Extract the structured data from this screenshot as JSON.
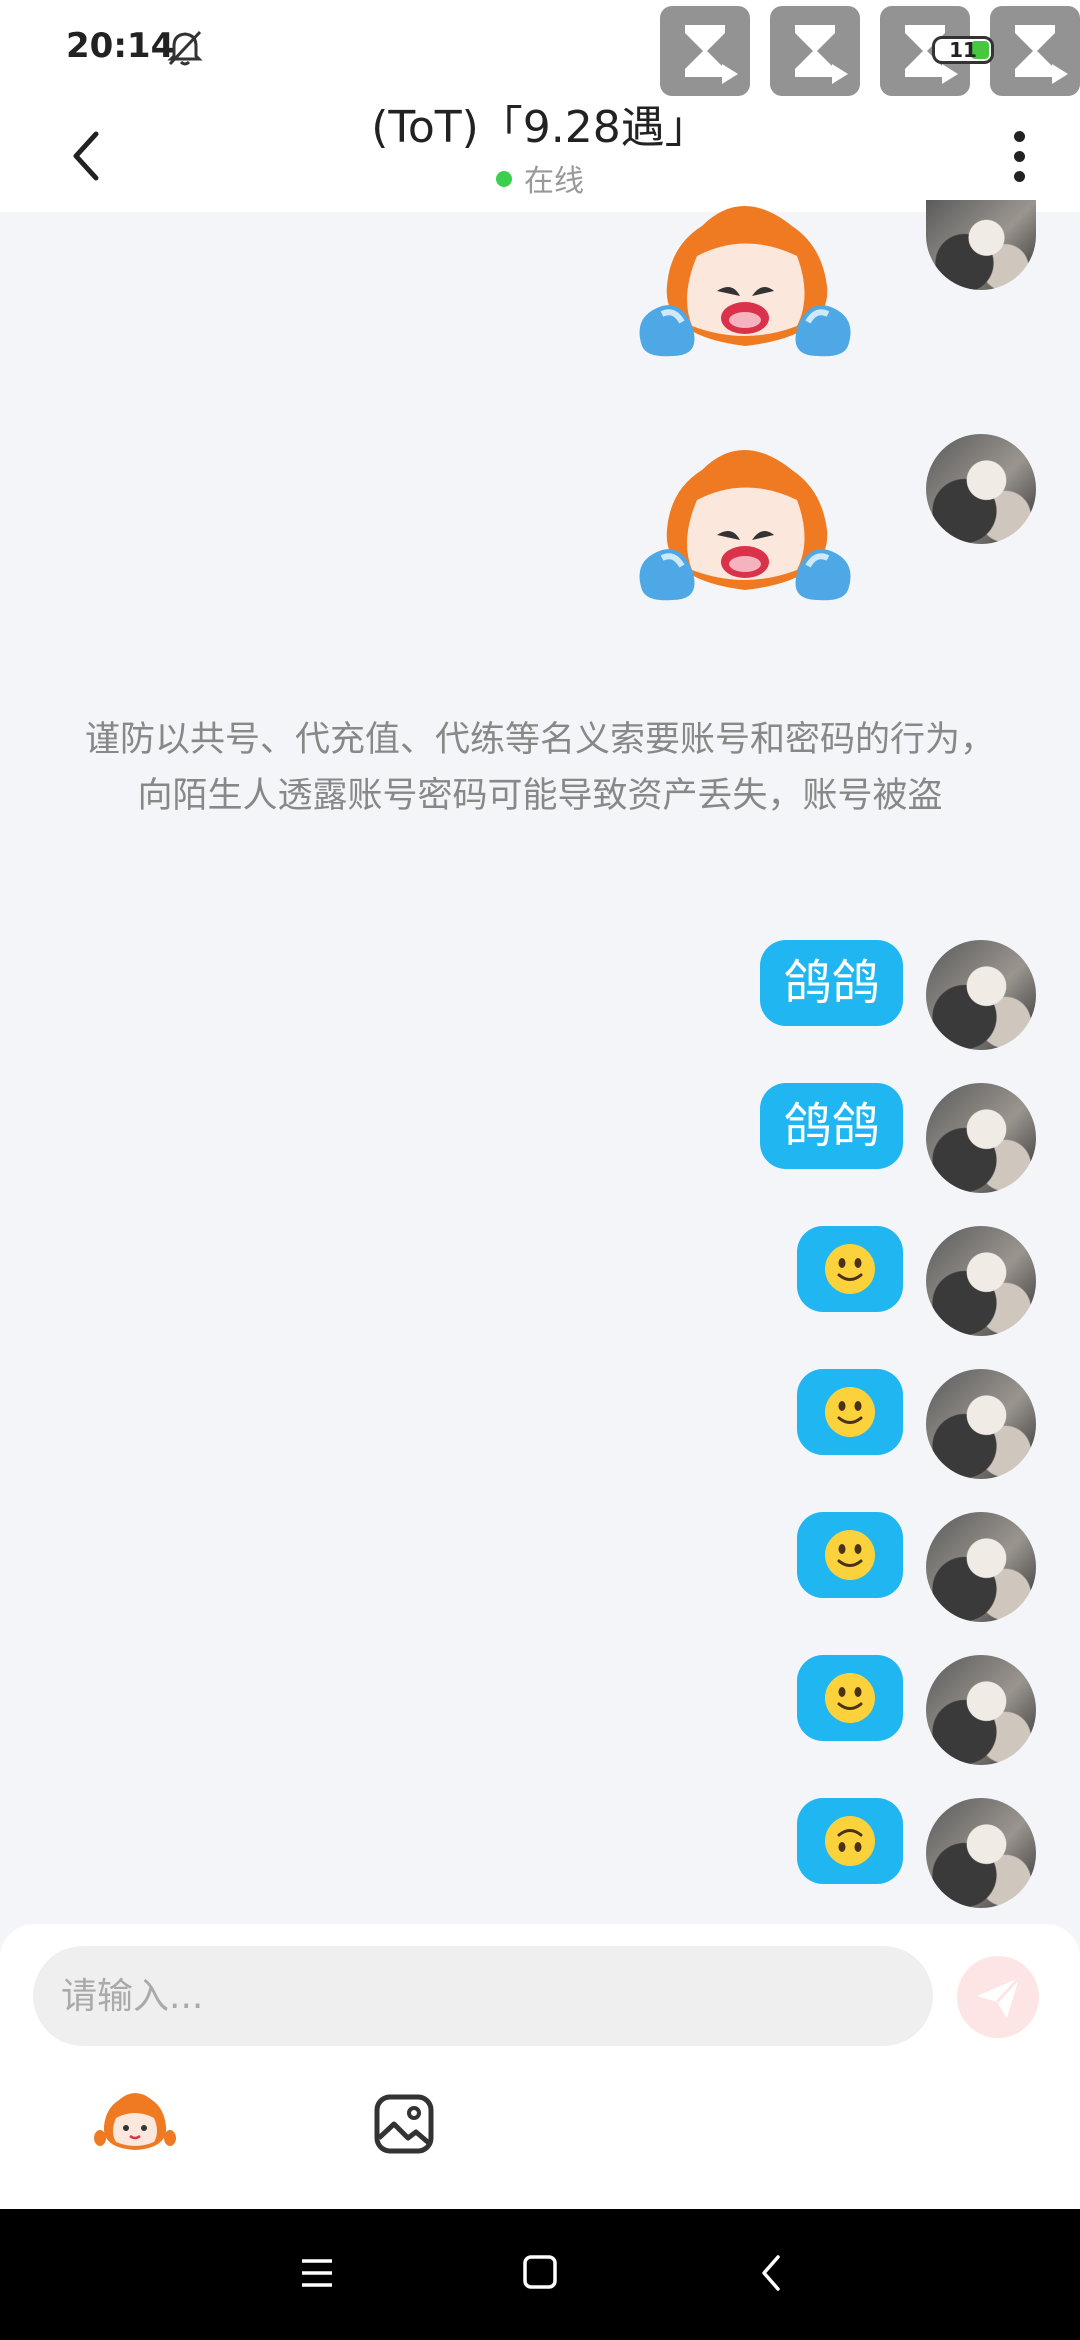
{
  "status_bar": {
    "time": "20:14",
    "battery": "11",
    "icons": [
      "bell-muted-icon",
      "hourglass-tile-icon",
      "wifi-icon",
      "battery-icon",
      "charging-icon"
    ]
  },
  "header": {
    "title": "(ToT)「9.28遇」",
    "status": "在线",
    "status_color": "#3ccf4e",
    "icons": [
      "back-arrow-icon",
      "more-vertical-icon"
    ]
  },
  "notice": "谨防以共号、代充值、代练等名义索要账号和密码的行为，向陌生人透露账号密码可能导致资产丢失，账号被盗",
  "messages": [
    {
      "type": "sticker",
      "icon": "crying-mascot-sticker"
    },
    {
      "type": "sticker",
      "icon": "crying-mascot-sticker"
    },
    {
      "type": "text",
      "text": "鸽鸽"
    },
    {
      "type": "text",
      "text": "鸽鸽"
    },
    {
      "type": "emoji",
      "icon": "slightly-smiling-face-emoji"
    },
    {
      "type": "emoji",
      "icon": "slightly-smiling-face-emoji"
    },
    {
      "type": "emoji",
      "icon": "slightly-smiling-face-emoji"
    },
    {
      "type": "emoji",
      "icon": "slightly-smiling-face-emoji"
    },
    {
      "type": "emoji",
      "icon": "upside-down-face-emoji"
    }
  ],
  "bubble_color": "#1fb6f2",
  "composer": {
    "placeholder": "请输入...",
    "icons": [
      "send-icon",
      "mascot-sticker-icon",
      "image-icon"
    ]
  },
  "nav_bar": {
    "icons": [
      "menu-icon",
      "home-icon",
      "back-icon"
    ]
  }
}
